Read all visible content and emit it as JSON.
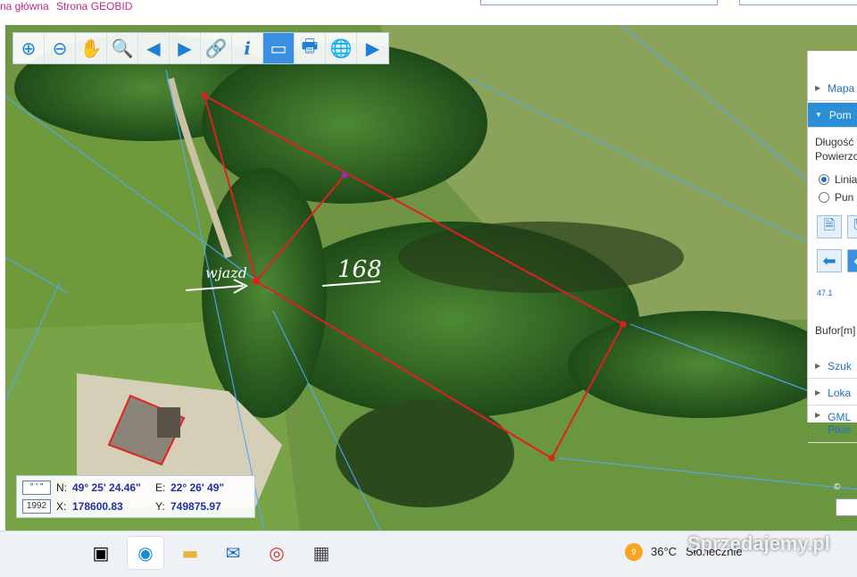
{
  "browser": {
    "links": [
      "na główna",
      "Strona GEOBID"
    ]
  },
  "toolbar": {
    "tools": [
      {
        "icon": "zoom-in-icon",
        "glyph": "⊕"
      },
      {
        "icon": "zoom-out-icon",
        "glyph": "⊖"
      },
      {
        "icon": "pan-hand-icon",
        "glyph": "✋"
      },
      {
        "icon": "zoom-extent-icon",
        "glyph": "🔍"
      },
      {
        "icon": "arrow-left-icon",
        "glyph": "◀"
      },
      {
        "icon": "arrow-right-icon",
        "glyph": "▶"
      },
      {
        "icon": "link-icon",
        "glyph": "🔗"
      },
      {
        "icon": "info-icon",
        "glyph": "i"
      },
      {
        "icon": "measure-ruler-icon",
        "glyph": "▭"
      },
      {
        "icon": "print-icon",
        "glyph": "🖶"
      },
      {
        "icon": "globe-icon",
        "glyph": "🌐"
      },
      {
        "icon": "video-camera-icon",
        "glyph": "▶"
      }
    ],
    "active_tool": "measure-ruler-icon"
  },
  "map": {
    "annotation_entrance": "wjazd",
    "annotation_parcel": "168",
    "parcel_color": "#e02020",
    "boundary_color": "#4fa8ff"
  },
  "panel": {
    "sections": [
      "Mapa",
      "Pom",
      "Szuk",
      "Loka",
      "GML",
      "Pikie"
    ],
    "active_section": "Pom",
    "length_label": "Długość",
    "area_label": "Powierzc",
    "radio_options": [
      "Linia",
      "Pun"
    ],
    "radio_selected": "Linia",
    "marker_label": "47.1",
    "buffer_label": "Bufor[m]"
  },
  "coords": {
    "geo_icon": "° ' \"",
    "system": "1992",
    "n_label": "N:",
    "n_value": "49° 25' 24.46\"",
    "e_label": "E:",
    "e_value": "22° 26' 49\"",
    "x_label": "X:",
    "x_value": "178600.83",
    "y_label": "Y:",
    "y_value": "749875.97"
  },
  "map_footer": {
    "copyright_prefix": "©"
  },
  "taskbar": {
    "apps": [
      "task-view-icon",
      "edge-browser-icon",
      "file-explorer-icon",
      "mail-icon",
      "chrome-icon",
      "calculator-icon"
    ],
    "active_app": "edge-browser-icon",
    "weather_badge": "9",
    "temperature": "36°C",
    "weather_text": "Słonecznie"
  },
  "watermark": "Sprzedajemy.pl"
}
